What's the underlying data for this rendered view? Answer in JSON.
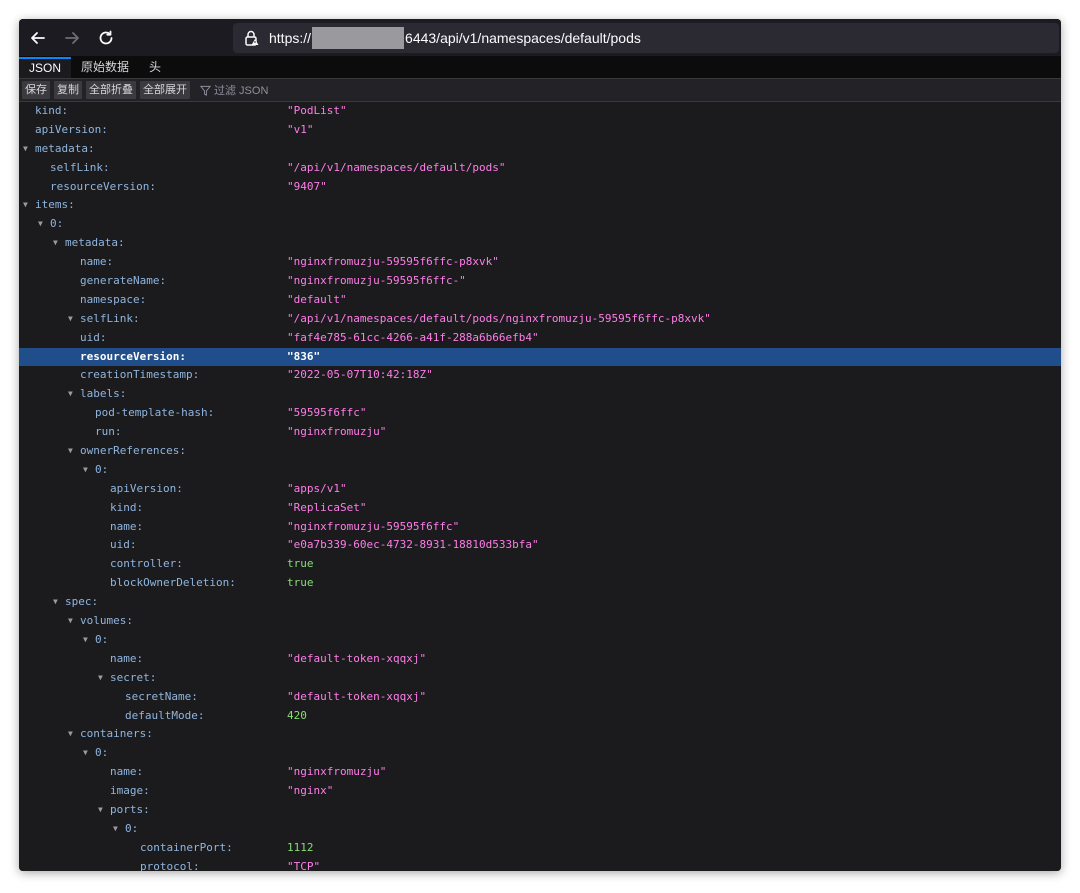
{
  "browser": {
    "url_prefix": "https://",
    "url_suffix": "6443/api/v1/namespaces/default/pods"
  },
  "tabs": [
    {
      "label": "JSON",
      "active": true
    },
    {
      "label": "原始数据",
      "active": false
    },
    {
      "label": "头",
      "active": false
    }
  ],
  "toolbar": {
    "save": "保存",
    "copy": "复制",
    "collapse_all": "全部折叠",
    "expand_all": "全部展开",
    "filter_placeholder": "过滤 JSON"
  },
  "colors": {
    "string": "#ff7de9",
    "number": "#86de74",
    "key": "#8fb5e0",
    "selected_row": "#204e8a"
  },
  "rows": [
    {
      "depth": 0,
      "key": "kind:",
      "value": "\"PodList\"",
      "type": "str"
    },
    {
      "depth": 0,
      "key": "apiVersion:",
      "value": "\"v1\"",
      "type": "str"
    },
    {
      "depth": 0,
      "key": "metadata:",
      "toggle": true
    },
    {
      "depth": 1,
      "key": "selfLink:",
      "value": "\"/api/v1/namespaces/default/pods\"",
      "type": "str"
    },
    {
      "depth": 1,
      "key": "resourceVersion:",
      "value": "\"9407\"",
      "type": "str"
    },
    {
      "depth": 0,
      "key": "items:",
      "toggle": true
    },
    {
      "depth": 1,
      "key": "0:",
      "toggle": true
    },
    {
      "depth": 2,
      "key": "metadata:",
      "toggle": true
    },
    {
      "depth": 3,
      "key": "name:",
      "value": "\"nginxfromuzju-59595f6ffc-p8xvk\"",
      "type": "str"
    },
    {
      "depth": 3,
      "key": "generateName:",
      "value": "\"nginxfromuzju-59595f6ffc-\"",
      "type": "str"
    },
    {
      "depth": 3,
      "key": "namespace:",
      "value": "\"default\"",
      "type": "str"
    },
    {
      "depth": 3,
      "key": "selfLink:",
      "value": "\"/api/v1/namespaces/default/pods/nginxfromuzju-59595f6ffc-p8xvk\"",
      "type": "str",
      "toggle": true
    },
    {
      "depth": 3,
      "key": "uid:",
      "value": "\"faf4e785-61cc-4266-a41f-288a6b66efb4\"",
      "type": "str"
    },
    {
      "depth": 3,
      "key": "resourceVersion:",
      "value": "\"836\"",
      "type": "str",
      "selected": true
    },
    {
      "depth": 3,
      "key": "creationTimestamp:",
      "value": "\"2022-05-07T10:42:18Z\"",
      "type": "str"
    },
    {
      "depth": 3,
      "key": "labels:",
      "toggle": true
    },
    {
      "depth": 4,
      "key": "pod-template-hash:",
      "value": "\"59595f6ffc\"",
      "type": "str"
    },
    {
      "depth": 4,
      "key": "run:",
      "value": "\"nginxfromuzju\"",
      "type": "str"
    },
    {
      "depth": 3,
      "key": "ownerReferences:",
      "toggle": true
    },
    {
      "depth": 4,
      "key": "0:",
      "toggle": true
    },
    {
      "depth": 5,
      "key": "apiVersion:",
      "value": "\"apps/v1\"",
      "type": "str"
    },
    {
      "depth": 5,
      "key": "kind:",
      "value": "\"ReplicaSet\"",
      "type": "str"
    },
    {
      "depth": 5,
      "key": "name:",
      "value": "\"nginxfromuzju-59595f6ffc\"",
      "type": "str"
    },
    {
      "depth": 5,
      "key": "uid:",
      "value": "\"e0a7b339-60ec-4732-8931-18810d533bfa\"",
      "type": "str"
    },
    {
      "depth": 5,
      "key": "controller:",
      "value": "true",
      "type": "bool"
    },
    {
      "depth": 5,
      "key": "blockOwnerDeletion:",
      "value": "true",
      "type": "bool"
    },
    {
      "depth": 2,
      "key": "spec:",
      "toggle": true
    },
    {
      "depth": 3,
      "key": "volumes:",
      "toggle": true
    },
    {
      "depth": 4,
      "key": "0:",
      "toggle": true
    },
    {
      "depth": 5,
      "key": "name:",
      "value": "\"default-token-xqqxj\"",
      "type": "str"
    },
    {
      "depth": 5,
      "key": "secret:",
      "toggle": true
    },
    {
      "depth": 6,
      "key": "secretName:",
      "value": "\"default-token-xqqxj\"",
      "type": "str"
    },
    {
      "depth": 6,
      "key": "defaultMode:",
      "value": "420",
      "type": "num"
    },
    {
      "depth": 3,
      "key": "containers:",
      "toggle": true
    },
    {
      "depth": 4,
      "key": "0:",
      "toggle": true
    },
    {
      "depth": 5,
      "key": "name:",
      "value": "\"nginxfromuzju\"",
      "type": "str"
    },
    {
      "depth": 5,
      "key": "image:",
      "value": "\"nginx\"",
      "type": "str"
    },
    {
      "depth": 5,
      "key": "ports:",
      "toggle": true
    },
    {
      "depth": 6,
      "key": "0:",
      "toggle": true
    },
    {
      "depth": 7,
      "key": "containerPort:",
      "value": "1112",
      "type": "num"
    },
    {
      "depth": 7,
      "key": "protocol:",
      "value": "\"TCP\"",
      "type": "str"
    }
  ]
}
